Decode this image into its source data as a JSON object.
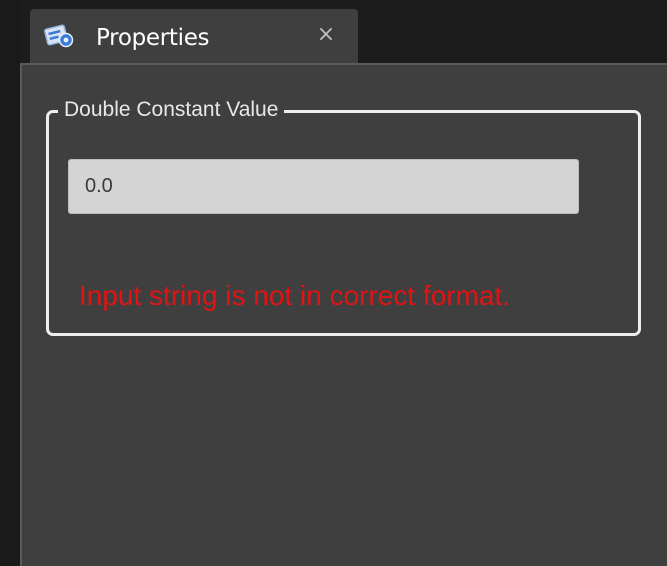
{
  "tab": {
    "title": "Properties",
    "close_label": "×",
    "icon": "properties-icon"
  },
  "group": {
    "label": "Double Constant Value",
    "input_value": "0.0",
    "error_message": "Input string is not in correct format."
  },
  "colors": {
    "background_dark": "#1c1c1c",
    "panel": "#3f3f3f",
    "group_border": "#eeeeee",
    "input_background": "#d4d4d4",
    "error": "#e01414",
    "tab_icon_accent": "#3b7bd6"
  }
}
